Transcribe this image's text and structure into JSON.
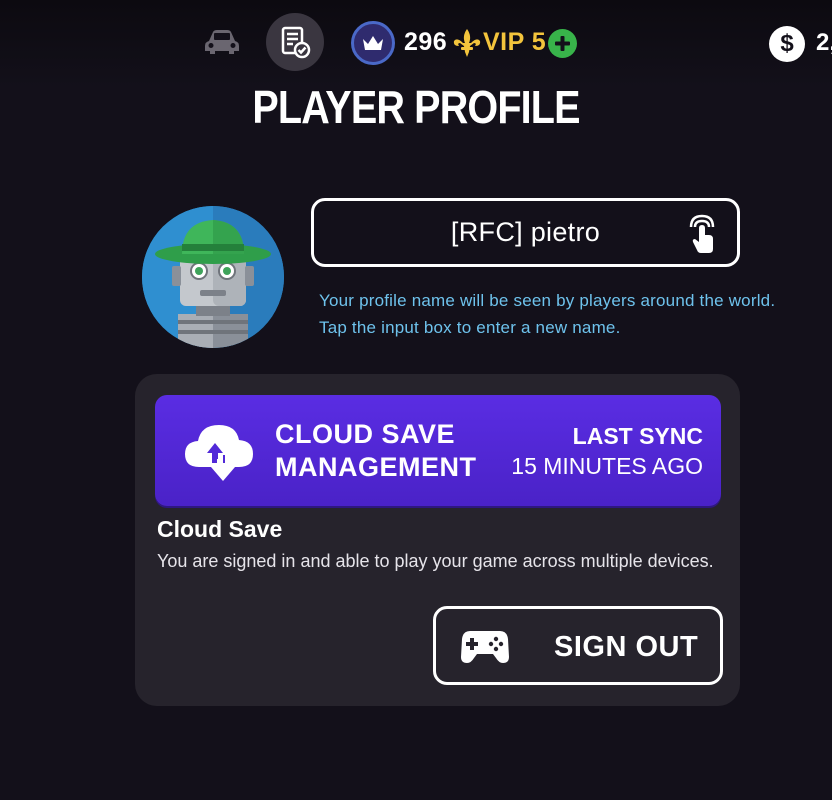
{
  "header": {
    "icons": [
      "car-icon",
      "records-check-icon",
      "crown-icon",
      "fleur-de-lis-icon",
      "plus-icon",
      "dollar-icon"
    ],
    "crown_count": "296",
    "vip_label": "VIP 5",
    "cash_value": "2,",
    "cash_symbol": "$"
  },
  "page": {
    "title": "PLAYER PROFILE"
  },
  "profile": {
    "name": "[RFC] pietro",
    "hint_line1": "Your profile name will be seen by players around the world.",
    "hint_line2": "Tap the input box to enter a new name.",
    "accent_color": "#6ec2ec"
  },
  "cloud": {
    "banner_title_line1": "CLOUD SAVE",
    "banner_title_line2": "MANAGEMENT",
    "last_sync_label": "LAST SYNC",
    "last_sync_value": "15 MINUTES AGO",
    "heading": "Cloud Save",
    "description": "You are signed in and able to play your game across multiple devices.",
    "sign_out_label": "SIGN OUT",
    "banner_color": "#5129d8"
  },
  "colors": {
    "background": "#13101a",
    "panel": "#26232c",
    "vip": "#f3c43c",
    "plus": "#38b34a"
  }
}
